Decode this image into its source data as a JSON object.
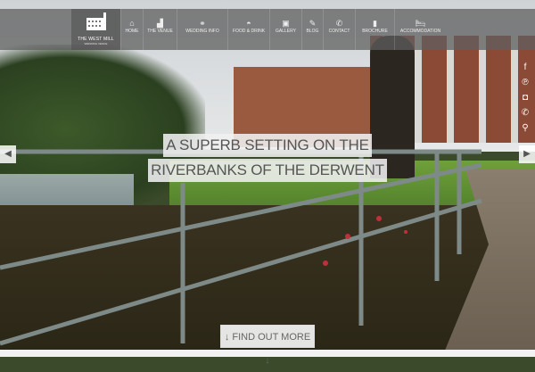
{
  "logo": {
    "name": "THE WEST MILL",
    "tagline": "WEDDING VENUE"
  },
  "nav": [
    {
      "label": "HOME",
      "icon": "home-icon",
      "glyph": "⌂"
    },
    {
      "label": "THE VENUE",
      "icon": "factory-icon",
      "glyph": "▟"
    },
    {
      "label": "WEDDING INFO",
      "icon": "rings-icon",
      "glyph": "⚭"
    },
    {
      "label": "FOOD & DRINK",
      "icon": "cloche-icon",
      "glyph": "◓"
    },
    {
      "label": "GALLERY",
      "icon": "photos-icon",
      "glyph": "▣"
    },
    {
      "label": "BLOG",
      "icon": "pencil-icon",
      "glyph": "✎"
    },
    {
      "label": "CONTACT",
      "icon": "phone-icon",
      "glyph": "✆"
    },
    {
      "label": "BROCHURE",
      "icon": "book-icon",
      "glyph": "▮"
    },
    {
      "label": "ACCOMMODATION",
      "icon": "bed-icon",
      "glyph": "🛏"
    }
  ],
  "social": [
    {
      "icon": "facebook-icon",
      "glyph": "f"
    },
    {
      "icon": "pinterest-icon",
      "glyph": "℗"
    },
    {
      "icon": "instagram-icon",
      "glyph": "◘"
    },
    {
      "icon": "phone-icon",
      "glyph": "✆"
    },
    {
      "icon": "location-pin-icon",
      "glyph": "⚲"
    }
  ],
  "hero": {
    "line1": "A SUPERB SETTING ON THE",
    "line2": "RIVERBANKS OF THE DERWENT",
    "cta": "↓ FIND OUT MORE ↓"
  },
  "arrows": {
    "prev": "◀",
    "next": "▶"
  }
}
